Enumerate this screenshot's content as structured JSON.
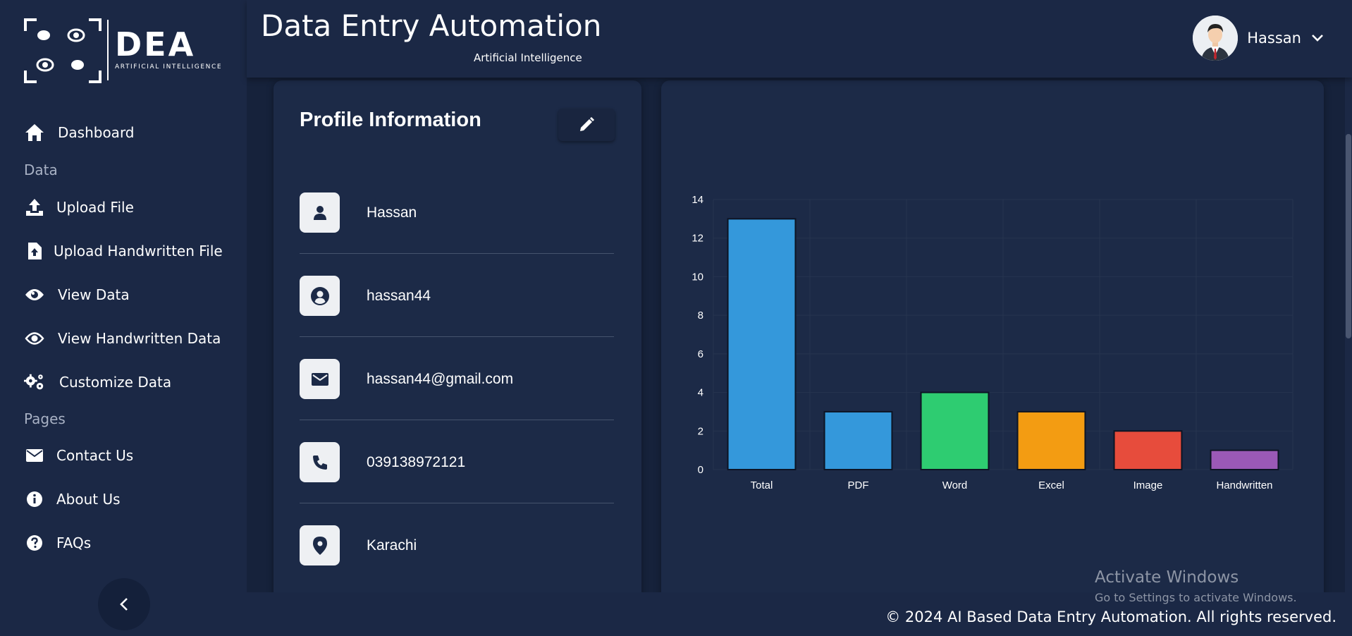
{
  "brand": {
    "logo_text": "DEA",
    "logo_subtext": "ARTIFICIAL INTELLIGENCE"
  },
  "sidebar": {
    "items": [
      {
        "label": "Dashboard",
        "icon": "home-icon"
      },
      {
        "label": "Upload File",
        "icon": "upload-icon"
      },
      {
        "label": "Upload Handwritten File",
        "icon": "file-upload-icon"
      },
      {
        "label": "View Data",
        "icon": "eye-icon"
      },
      {
        "label": "View Handwritten Data",
        "icon": "eye-icon"
      },
      {
        "label": "Customize Data",
        "icon": "cogs-icon"
      },
      {
        "label": "Contact Us",
        "icon": "envelope-icon"
      },
      {
        "label": "About Us",
        "icon": "info-icon"
      },
      {
        "label": "FAQs",
        "icon": "question-icon"
      }
    ],
    "sections": [
      "Data",
      "Pages"
    ]
  },
  "header": {
    "title": "Data Entry Automation",
    "subtitle": "Artificial Intelligence",
    "user_name": "Hassan"
  },
  "profile": {
    "title": "Profile Information",
    "name": "Hassan",
    "username": "hassan44",
    "email": "hassan44@gmail.com",
    "phone": "039138972121",
    "city": "Karachi"
  },
  "chart_data": {
    "type": "bar",
    "categories": [
      "Total",
      "PDF",
      "Word",
      "Excel",
      "Image",
      "Handwritten"
    ],
    "values": [
      13,
      3,
      4,
      3,
      2,
      1
    ],
    "colors": [
      "#3498db",
      "#3498db",
      "#2ecc71",
      "#f39c12",
      "#e74c3c",
      "#9b59b6"
    ],
    "ylim": [
      0,
      14
    ],
    "yticks": [
      0,
      2,
      4,
      6,
      8,
      10,
      12,
      14
    ],
    "grid": true
  },
  "footer": {
    "copyright": "© 2024 AI Based Data Entry Automation. All rights reserved."
  },
  "watermark": {
    "line1": "Activate Windows",
    "line2": "Go to Settings to activate Windows."
  },
  "colors": {
    "background": "#1a2744",
    "card": "#1c2a47",
    "text": "#ffffff"
  }
}
